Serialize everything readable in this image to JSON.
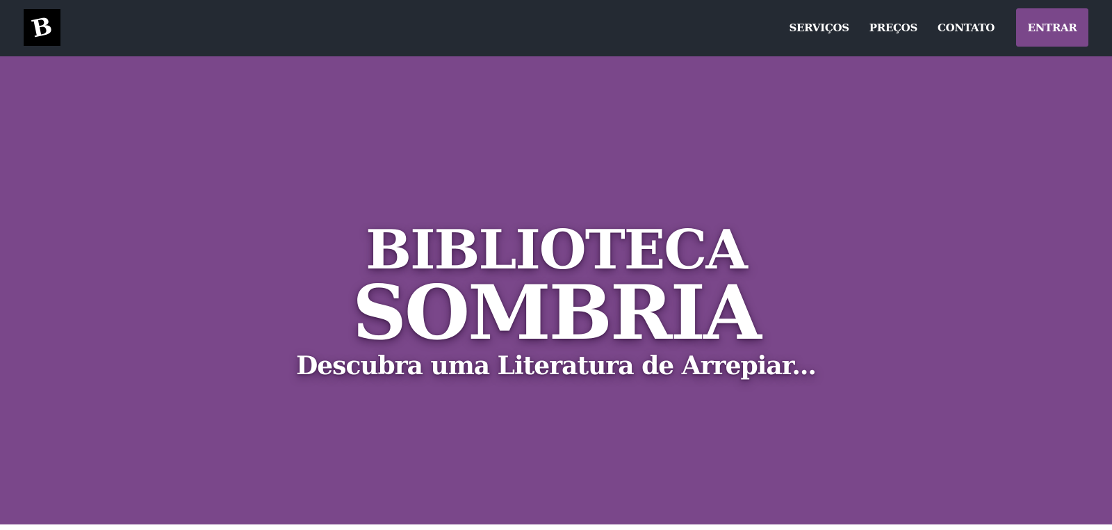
{
  "navbar": {
    "logo_letter": "B",
    "links": [
      "SERVIÇOS",
      "PREÇOS",
      "CONTATO"
    ],
    "cta_label": "ENTRAR",
    "background_color": "#242a33"
  },
  "hero": {
    "title_line1": "BIBLIOTECA",
    "title_line2": "SOMBRIA",
    "subtitle": "Descubra uma Literatura de Arrepiar...",
    "background_color": "#7a478a"
  },
  "colors": {
    "accent": "#7a478a",
    "text": "#ffffff"
  }
}
